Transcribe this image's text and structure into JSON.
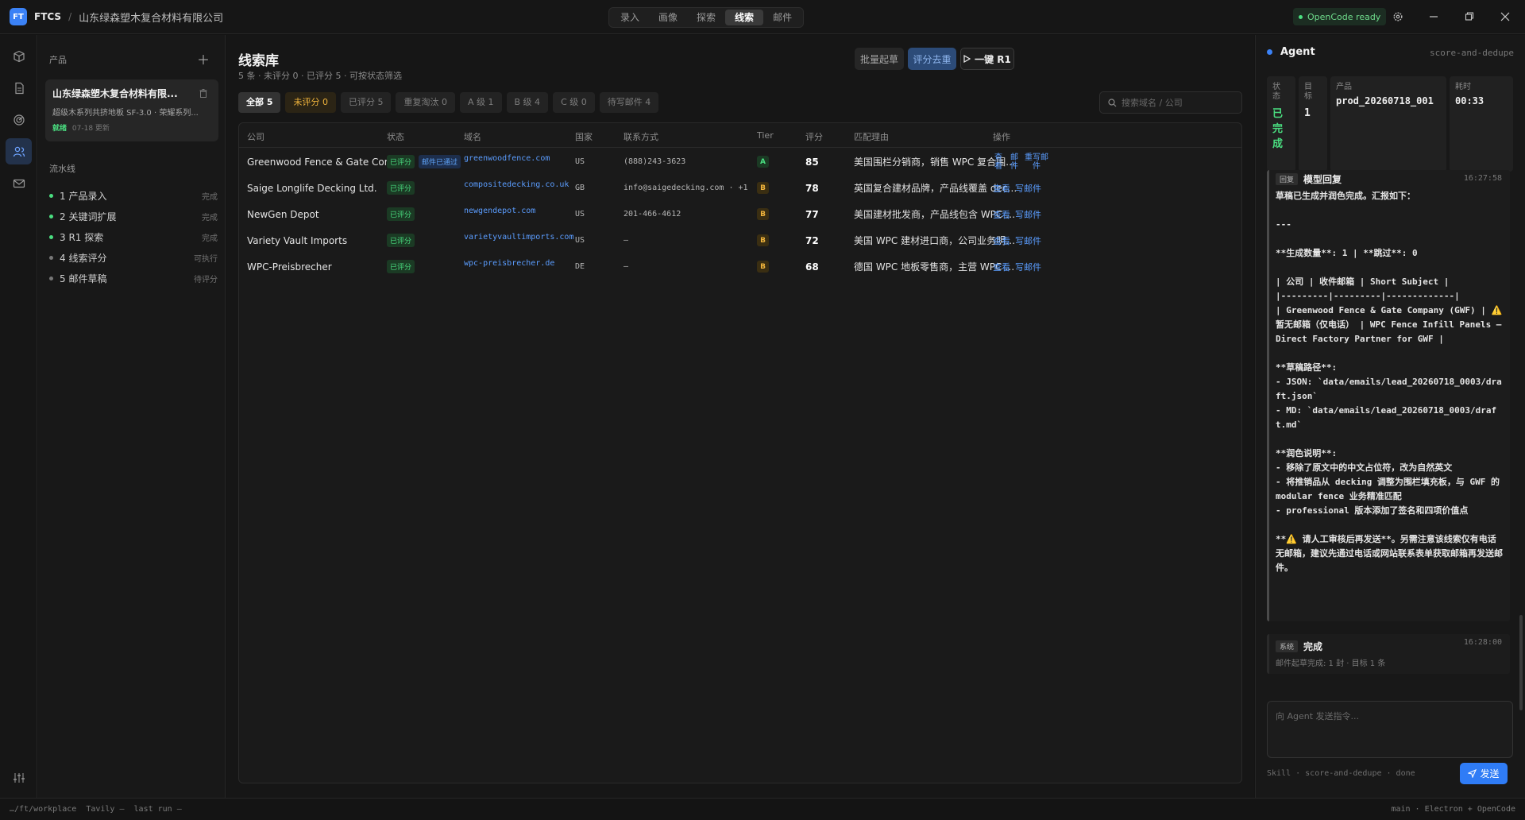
{
  "app": {
    "logo_text": "FT",
    "name": "FTCS",
    "separator": "/",
    "company": "山东绿森塑木复合材料有限公司"
  },
  "nav_tabs": [
    "录入",
    "画像",
    "探索",
    "线索",
    "邮件"
  ],
  "nav_active": "线索",
  "status_pill": "OpenCode ready",
  "sidebar": {
    "products_label": "产品",
    "product": {
      "name": "山东绿森塑木复合材料有限...",
      "desc": "超级木系列共挤地板 SF-3.0 · 荣耀系列...",
      "status": "就绪",
      "updated": "07-18 更新"
    },
    "pipeline_label": "流水线",
    "pipeline": [
      {
        "label": "1 产品录入",
        "status": "完成",
        "color": "#4ade80"
      },
      {
        "label": "2 关键词扩展",
        "status": "完成",
        "color": "#4ade80"
      },
      {
        "label": "3 R1 探索",
        "status": "完成",
        "color": "#4ade80"
      },
      {
        "label": "4 线索评分",
        "status": "可执行",
        "color": "#777777"
      },
      {
        "label": "5 邮件草稿",
        "status": "待评分",
        "color": "#777777"
      }
    ]
  },
  "main": {
    "title": "线索库",
    "subtitle": "5 条 · 未评分 0 · 已评分 5 · 可按状态筛选",
    "buttons": {
      "batch": "批量起草",
      "score": "评分去重",
      "r1": "一键 R1"
    },
    "filters": [
      "全部 5",
      "未评分 0",
      "已评分 5",
      "重复淘汰 0",
      "A 级 1",
      "B 级 4",
      "C 级 0",
      "待写邮件 4"
    ],
    "search_placeholder": "搜索域名 / 公司",
    "columns": [
      "公司",
      "状态",
      "域名",
      "国家",
      "联系方式",
      "Tier",
      "评分",
      "匹配理由",
      "操作"
    ],
    "rows": [
      {
        "company": "Greenwood Fence & Gate Company (...",
        "status": "已评分",
        "extra_badge": "邮件已通过",
        "domain": "greenwoodfence.com",
        "country": "US",
        "contact": "(888)243-3623",
        "tier": "A",
        "score": "85",
        "reason": "美国围栏分销商，销售 WPC 复合围栏...",
        "actions": [
          "查看",
          "邮件",
          "重写邮件"
        ]
      },
      {
        "company": "Saige Longlife Decking Ltd.",
        "status": "已评分",
        "extra_badge": "",
        "domain": "compositedecking.co.uk",
        "country": "GB",
        "contact": "info@saigedecking.com · +1",
        "tier": "B",
        "score": "78",
        "reason": "英国复合建材品牌，产品线覆盖 decki...",
        "actions": [
          "查看",
          "写邮件"
        ]
      },
      {
        "company": "NewGen Depot",
        "status": "已评分",
        "extra_badge": "",
        "domain": "newgendepot.com",
        "country": "US",
        "contact": "201-466-4612",
        "tier": "B",
        "score": "77",
        "reason": "美国建材批发商，产品线包含 WPC 复...",
        "actions": [
          "查看",
          "写邮件"
        ]
      },
      {
        "company": "Variety Vault Imports",
        "status": "已评分",
        "extra_badge": "",
        "domain": "varietyvaultimports.com",
        "country": "US",
        "contact": "—",
        "tier": "B",
        "score": "72",
        "reason": "美国 WPC 建材进口商，公司业务明确...",
        "actions": [
          "查看",
          "写邮件"
        ]
      },
      {
        "company": "WPC-Preisbrecher",
        "status": "已评分",
        "extra_badge": "",
        "domain": "wpc-preisbrecher.de",
        "country": "DE",
        "contact": "—",
        "tier": "B",
        "score": "68",
        "reason": "德国 WPC 地板零售商，主营 WPC 露...",
        "actions": [
          "查看",
          "写邮件"
        ]
      }
    ]
  },
  "agent": {
    "title": "Agent",
    "skill": "score-and-dedupe",
    "stats": [
      {
        "key": "状\n态",
        "value": "已\n完\n成"
      },
      {
        "key": "目\n标",
        "value": "1"
      },
      {
        "key": "产品",
        "value": "prod_20260718_001"
      },
      {
        "key": "耗时",
        "value": "00:33"
      }
    ],
    "messages": [
      {
        "tag": "回复",
        "title": "模型回复",
        "time": "16:27:58",
        "body": "草稿已生成并润色完成。汇报如下：\n\n---\n\n**生成数量**: 1 | **跳过**: 0\n\n| 公司 | 收件邮箱 | Short Subject |\n|---------|---------|-------------|\n| Greenwood Fence & Gate Company (GWF) | ⚠️ 暂无邮箱（仅电话） | WPC Fence Infill Panels — Direct Factory Partner for GWF |\n\n**草稿路径**:\n- JSON: `data/emails/lead_20260718_0003/draft.json`\n- MD: `data/emails/lead_20260718_0003/draft.md`\n\n**润色说明**:\n- 移除了原文中的中文占位符，改为自然英文\n- 将推销品从 decking 调整为围栏填充板，与 GWF 的 modular fence 业务精准匹配\n- professional 版本添加了签名和四项价值点\n\n**⚠️ 请人工审核后再发送**。另需注意该线索仅有电话无邮箱，建议先通过电话或网站联系表单获取邮箱再发送邮件。"
      },
      {
        "tag": "系统",
        "title": "完成",
        "time": "16:28:00",
        "body": "邮件起草完成: 1 封 · 目标 1 条"
      }
    ],
    "input_placeholder": "向 Agent 发送指令...",
    "footer": "Skill · score-and-dedupe · done",
    "send_label": "发送"
  },
  "statusbar": {
    "left": "…/ft/workplace  Tavily —  last run —",
    "right": "main · Electron + OpenCode"
  },
  "colors": {
    "accent": "#3b82f6",
    "success": "#4ade80",
    "warning": "#f0b43c",
    "link": "#5b9dff"
  }
}
